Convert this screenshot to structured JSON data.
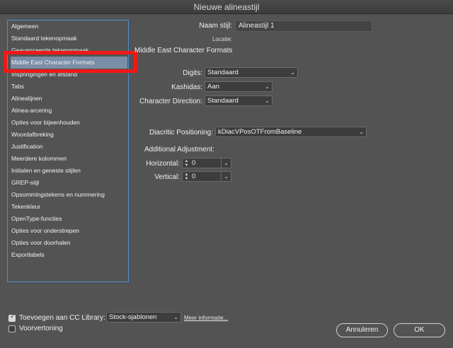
{
  "window": {
    "title": "Nieuwe alineastijl"
  },
  "sidebar": {
    "items": [
      {
        "label": "Algemeen"
      },
      {
        "label": "Standaard tekenopmaak"
      },
      {
        "label": "Geavanceerde tekenopmaak"
      },
      {
        "label": "Middle East Character Formats",
        "selected": true
      },
      {
        "label": "Inspringingen en afstand"
      },
      {
        "label": "Tabs"
      },
      {
        "label": "Alinealijnen"
      },
      {
        "label": "Alinea-arcering"
      },
      {
        "label": "Opties voor bijeenhouden"
      },
      {
        "label": "Woordafbreking"
      },
      {
        "label": "Justification"
      },
      {
        "label": "Meerdere kolommen"
      },
      {
        "label": "Initialen en geneste stijlen"
      },
      {
        "label": "GREP-stijl"
      },
      {
        "label": "Opsommingstekens en nummering"
      },
      {
        "label": "Tekenkleur"
      },
      {
        "label": "OpenType-functies"
      },
      {
        "label": "Opties voor onderstrepen"
      },
      {
        "label": "Opties voor doorhalen"
      },
      {
        "label": "Exportlabels"
      }
    ]
  },
  "header": {
    "style_name_label": "Naam stijl:",
    "style_name_value": "Alineastijl 1",
    "location_label": "Locatie:",
    "section_title": "Middle East Character Formats"
  },
  "form": {
    "digits_label": "Digits:",
    "digits_value": "Standaard",
    "kashidas_label": "Kashidas:",
    "kashidas_value": "Aan",
    "char_direction_label": "Character Direction:",
    "char_direction_value": "Standaard",
    "diacritic_label": "Diacritic Positioning:",
    "diacritic_value": "kDiacVPosOTFromBaseline",
    "additional_label": "Additional Adjustment:",
    "horizontal_label": "Horizontal:",
    "horizontal_value": "0",
    "vertical_label": "Vertical:",
    "vertical_value": "0"
  },
  "footer": {
    "cc_checkbox_label": "Toevoegen aan CC Library:",
    "cc_checked": true,
    "library_value": "Stock-sjablonen",
    "more_info_link": "Meer informatie...",
    "preview_label": "Voorvertoning",
    "preview_checked": false,
    "cancel_label": "Annuleren",
    "ok_label": "OK"
  },
  "colors": {
    "background": "#535353",
    "sidebar_border": "#4f8ccf",
    "selection": "#7a8ea8",
    "highlight_box": "#f01818"
  }
}
